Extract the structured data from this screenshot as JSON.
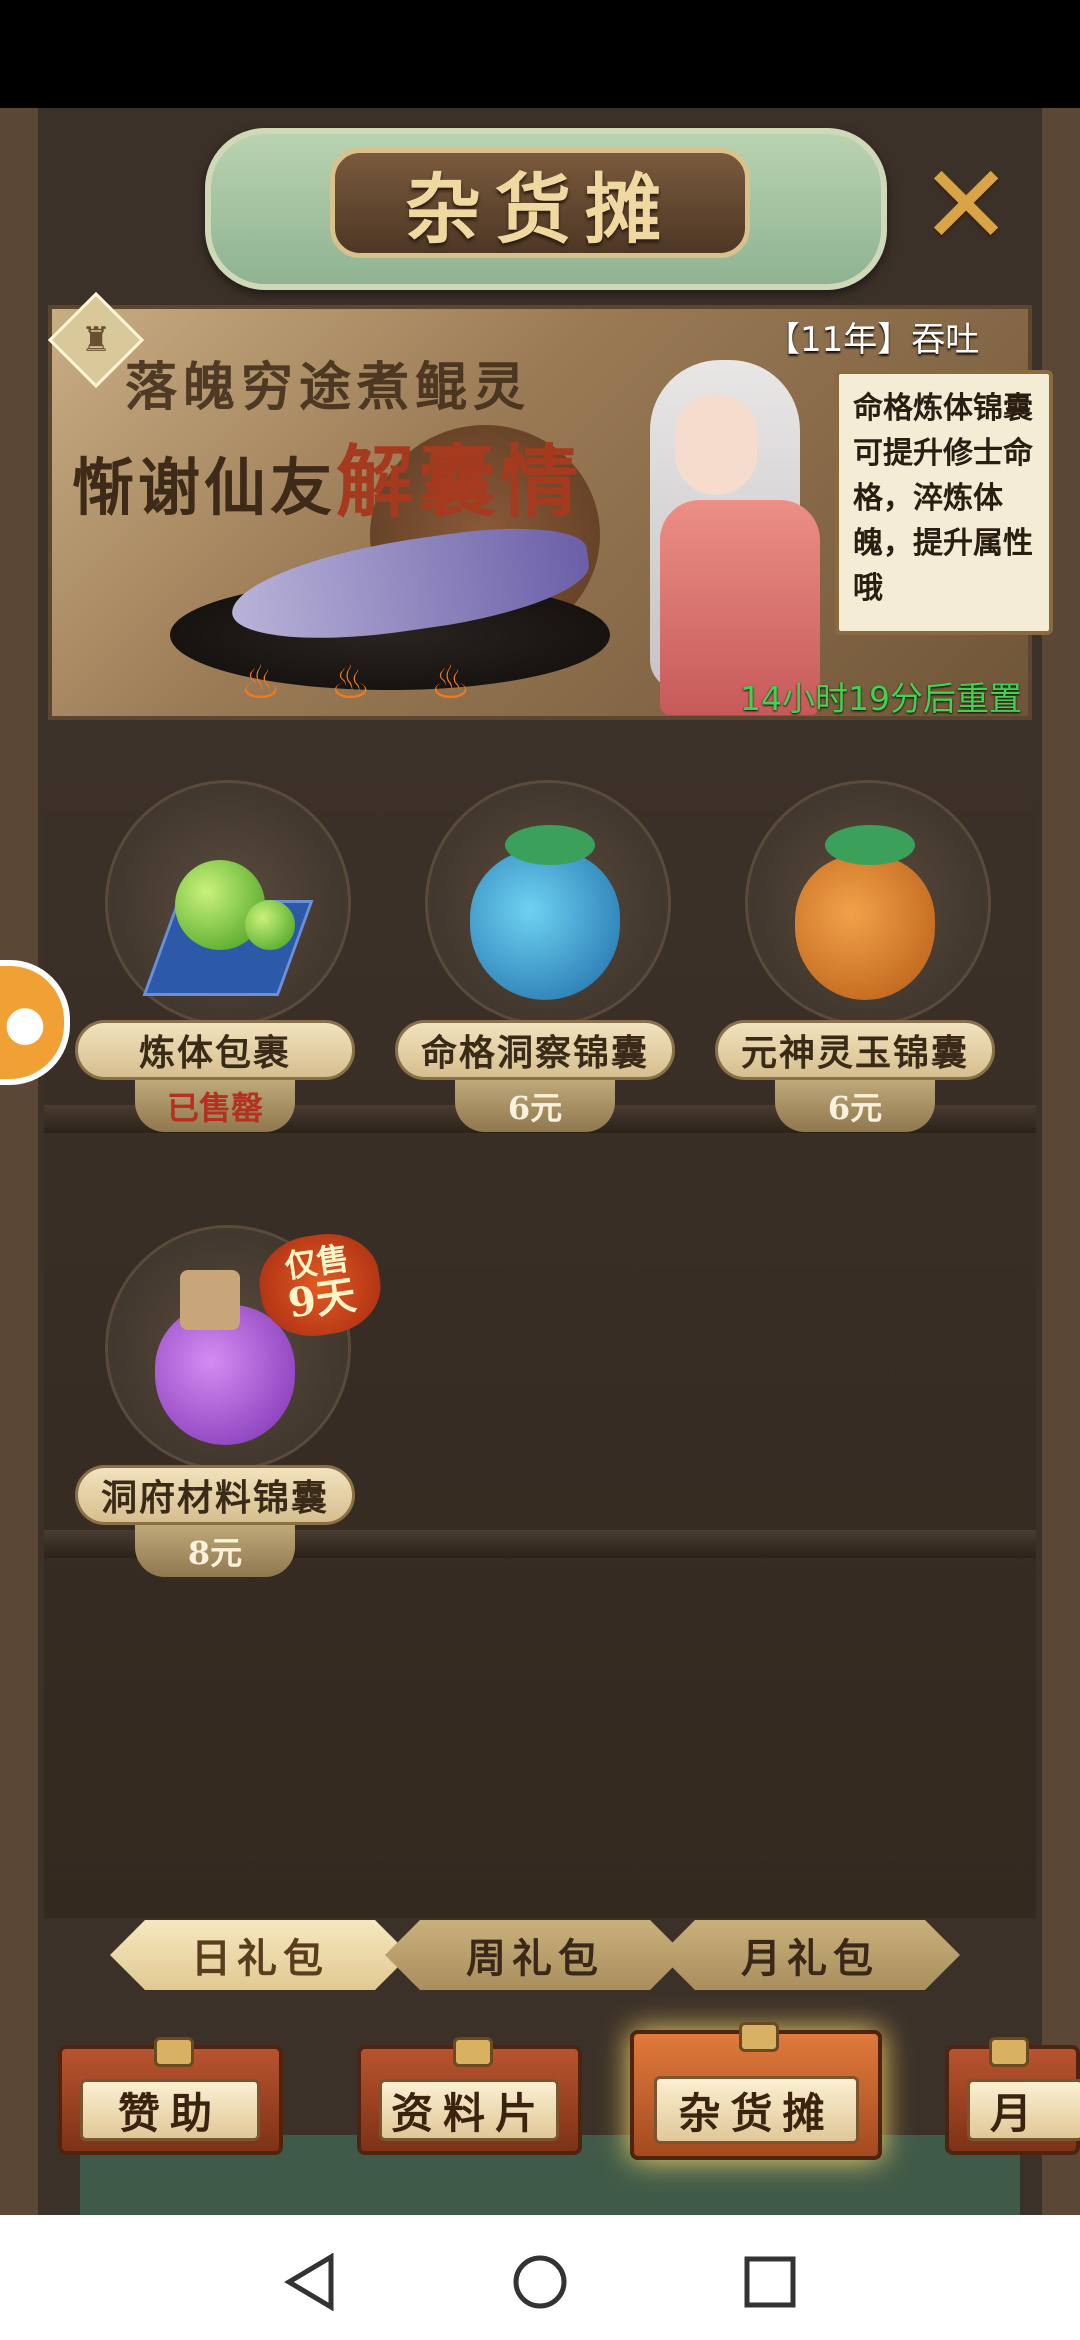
{
  "header": {
    "title": "杂货摊"
  },
  "banner": {
    "line1": "落魄穷途煮鲲灵",
    "line2_prefix": "惭谢仙友",
    "line2_emph": "解囊情",
    "ticker": "【11年】吞吐",
    "tip": "命格炼体锦囊可提升修士命格，淬炼体魄，提升属性哦",
    "reset_timer": "14小时19分后重置"
  },
  "items": [
    {
      "name": "炼体包裹",
      "price": "已售罄",
      "sold_out": true
    },
    {
      "name": "命格洞察锦囊",
      "price": "6元",
      "sold_out": false
    },
    {
      "name": "元神灵玉锦囊",
      "price": "6元",
      "sold_out": false
    },
    {
      "name": "洞府材料锦囊",
      "price": "8元",
      "sold_out": false,
      "badge_line1": "仅售",
      "badge_line2": "9天"
    }
  ],
  "tabs": [
    {
      "label": "日礼包",
      "active": true
    },
    {
      "label": "周礼包",
      "active": false
    },
    {
      "label": "月礼包",
      "active": false
    }
  ],
  "bottom_nav": [
    {
      "label": "赞助"
    },
    {
      "label": "资料片"
    },
    {
      "label": "杂货摊",
      "active": true
    },
    {
      "label": "月"
    }
  ],
  "colors": {
    "accent_gold": "#d9a446",
    "timer_green": "#3fd34f",
    "sold_out_red": "#b5301f"
  },
  "icons": {
    "close": "close-x-icon",
    "side": "game-controller-icon"
  }
}
